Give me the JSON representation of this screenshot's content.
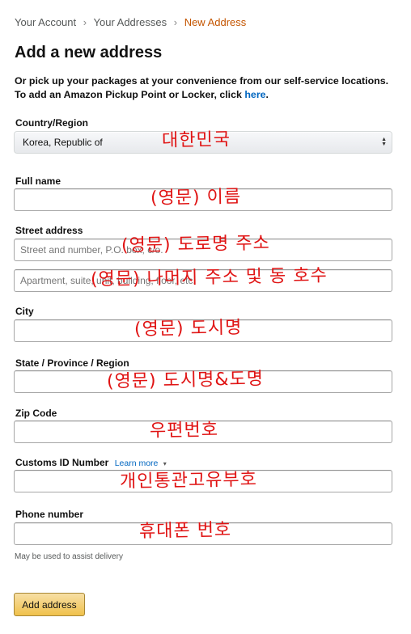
{
  "breadcrumb": {
    "items": [
      "Your Account",
      "Your Addresses",
      "New Address"
    ],
    "separator": "›"
  },
  "page_title": "Add a new address",
  "intro": {
    "text": "Or pick up your packages at your convenience from our self-service locations. To add an Amazon Pickup Point or Locker, click ",
    "link": "here",
    "end": "."
  },
  "country": {
    "label": "Country/Region",
    "value": "Korea, Republic of"
  },
  "full_name": {
    "label": "Full name",
    "value": ""
  },
  "street": {
    "label": "Street address",
    "placeholder1": "Street and number, P.O. box, c/o.",
    "placeholder2": "Apartment, suite, unit, building, floor, etc."
  },
  "city": {
    "label": "City",
    "value": ""
  },
  "state": {
    "label": "State / Province / Region",
    "value": ""
  },
  "zip": {
    "label": "Zip Code",
    "value": ""
  },
  "customs": {
    "label": "Customs ID Number",
    "learn_more": "Learn more",
    "caret": "▾",
    "value": ""
  },
  "phone": {
    "label": "Phone number",
    "value": "",
    "hint": "May be used to assist delivery"
  },
  "submit": {
    "label": "Add address"
  },
  "annotations": {
    "country": "대한민국",
    "full_name": "(영문) 이름",
    "street1": "(영문) 도로명 주소",
    "street2": "(영문) 나머지 주소 및 동 호수",
    "city": "(영문) 도시명",
    "state": "(영문) 도시명&도명",
    "zip": "우편번호",
    "customs": "개인통관고유부호",
    "phone": "휴대폰 번호"
  },
  "colors": {
    "link": "#0066c0",
    "breadcrumb_current": "#c45500",
    "button": "#f0c14b",
    "annotation": "#e01414"
  }
}
